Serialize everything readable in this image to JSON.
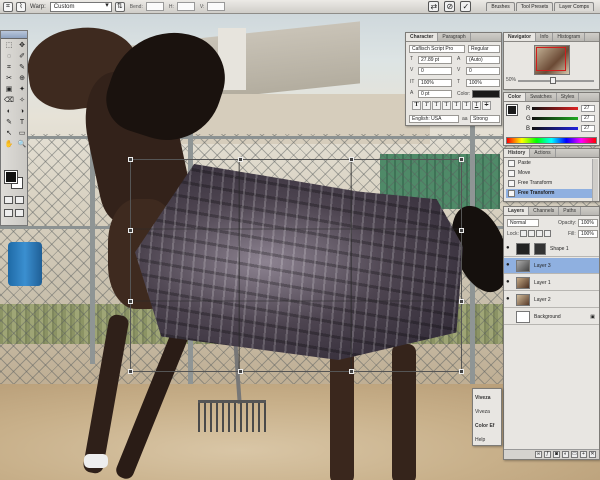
{
  "optionbar": {
    "warp_label": "Warp:",
    "warp_value": "Custom",
    "bend_label": "Bend:",
    "h_label": "H:",
    "v_label": "V:",
    "wells": [
      "Brushes",
      "Tool Presets",
      "Layer Comps"
    ]
  },
  "toolbox": {
    "tools": [
      "⬚",
      "✥",
      "◌",
      "✐",
      "⌗",
      "✎",
      "✂",
      "⊕",
      "▣",
      "✦",
      "⌫",
      "✧",
      "◐",
      "◑",
      "✎",
      "T",
      "↖",
      "▭",
      "✋",
      "🔍"
    ]
  },
  "character": {
    "tabs": [
      "Character",
      "Paragraph"
    ],
    "font_family": "Caflisch Script Pro",
    "font_style": "Regular",
    "size": "27.89 pt",
    "leading": "(Auto)",
    "kerning": "0",
    "tracking": "0",
    "vscale": "100%",
    "hscale": "100%",
    "baseline": "0 pt",
    "color_label": "Color:",
    "format_buttons": [
      "T",
      "T",
      "T",
      "T",
      "T",
      "T",
      "T",
      "T"
    ],
    "language": "English: USA",
    "aa_label": "aa",
    "antialias": "Strong"
  },
  "navigator": {
    "tabs": [
      "Navigator",
      "Info",
      "Histogram"
    ],
    "zoom": "50%"
  },
  "colorpanel": {
    "tabs": [
      "Color",
      "Swatches",
      "Styles"
    ],
    "channels": [
      {
        "label": "R",
        "value": "27",
        "color": "#d22"
      },
      {
        "label": "G",
        "value": "27",
        "color": "#2a2"
      },
      {
        "label": "B",
        "value": "27",
        "color": "#22d"
      }
    ]
  },
  "history": {
    "tabs": [
      "History",
      "Actions"
    ],
    "items": [
      "Paste",
      "Move",
      "Free Transform",
      "Free Transform"
    ],
    "selected_index": 3
  },
  "layers": {
    "tabs": [
      "Layers",
      "Channels",
      "Paths"
    ],
    "blend_mode": "Normal",
    "opacity_label": "Opacity:",
    "opacity": "100%",
    "lock_label": "Lock:",
    "fill_label": "Fill:",
    "fill": "100%",
    "items": [
      {
        "name": "Shape 1",
        "selected": false
      },
      {
        "name": "Layer 3",
        "selected": true
      },
      {
        "name": "Layer 1",
        "selected": false
      },
      {
        "name": "Layer 2",
        "selected": false
      },
      {
        "name": "Background",
        "selected": false
      }
    ]
  },
  "mini": {
    "items": [
      "Viveza",
      "Viveza",
      "Color Ef",
      "Help"
    ]
  }
}
